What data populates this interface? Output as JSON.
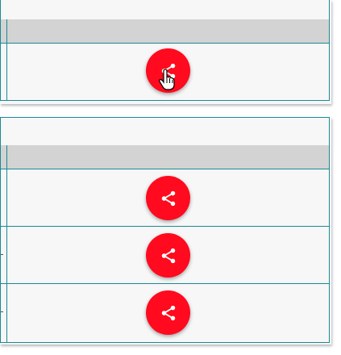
{
  "tables": [
    {
      "id": "top",
      "row_count": 1,
      "share_button_label": "share"
    },
    {
      "id": "bottom",
      "row_count": 3,
      "share_button_label": "share"
    }
  ],
  "icons": {
    "share": "share-icon",
    "cursor": "hand-pointer-icon"
  },
  "colors": {
    "accent": "#ff0a1e",
    "border": "#1a8a94",
    "header_bg": "#d3d3d3",
    "card_bg": "#f7f7f7"
  }
}
